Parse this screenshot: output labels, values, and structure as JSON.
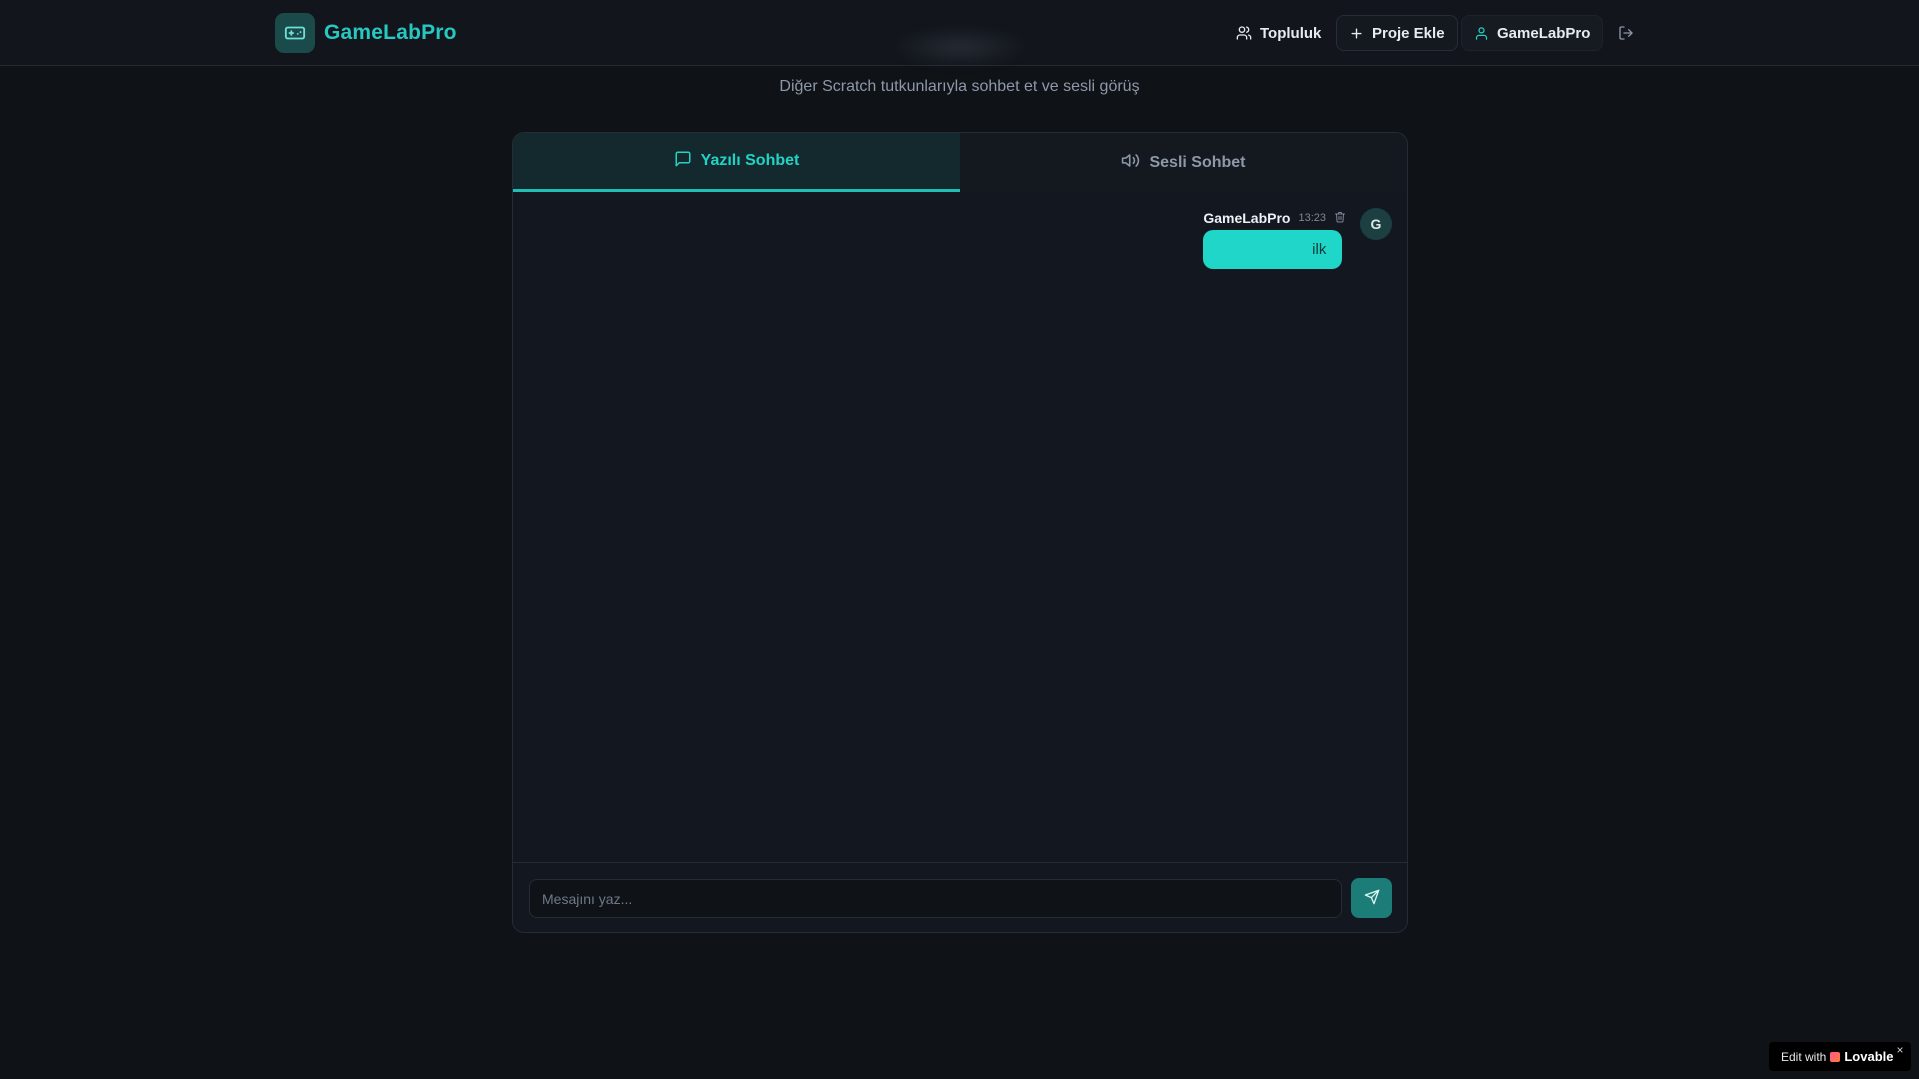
{
  "app": {
    "name": "GameLabPro",
    "accent": "#22d3c5"
  },
  "header": {
    "nav": {
      "community_label": "Topluluk",
      "add_project_label": "Proje Ekle",
      "user_label": "GameLabPro"
    },
    "icons": {
      "logo": "gamepad-icon",
      "community": "users-icon",
      "add_project": "plus-icon",
      "user": "user-icon",
      "logout": "logout-icon"
    }
  },
  "page": {
    "subtitle": "Diğer Scratch tutkunlarıyla sohbet et ve sesli görüş"
  },
  "chat": {
    "tabs": [
      {
        "label": "Yazılı Sohbet",
        "icon": "message-square-icon",
        "active": true
      },
      {
        "label": "Sesli Sohbet",
        "icon": "volume-icon",
        "active": false
      }
    ],
    "messages": [
      {
        "author": "GameLabPro",
        "time": "13:23",
        "text": "ilk",
        "avatar_initial": "G"
      }
    ],
    "composer": {
      "placeholder": "Mesajını yaz...",
      "value": ""
    }
  },
  "badge": {
    "prefix": "Edit with",
    "brand": "Lovable",
    "close": "×"
  }
}
